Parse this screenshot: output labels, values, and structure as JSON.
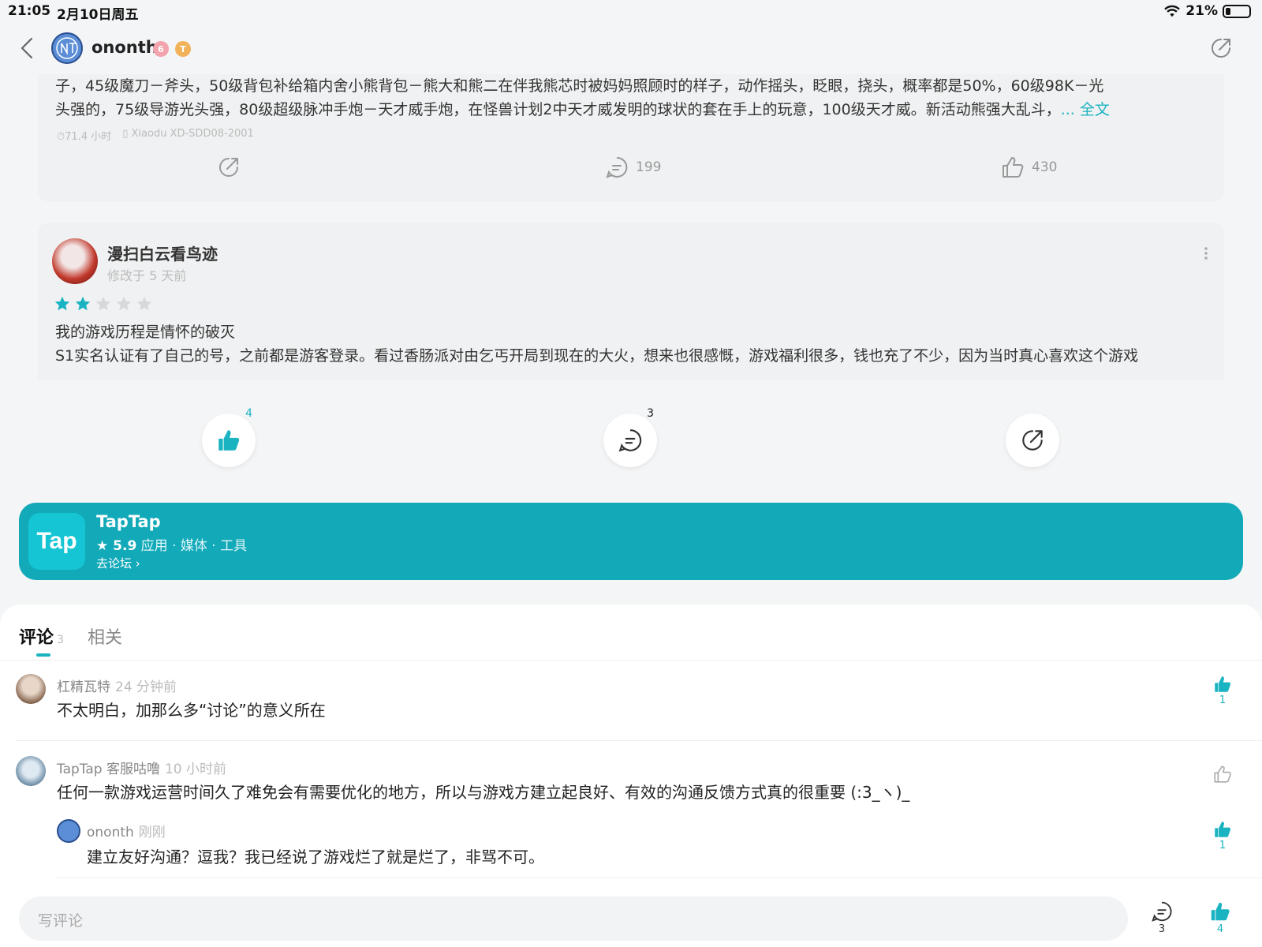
{
  "status": {
    "time": "21:05",
    "date": "2月10日周五",
    "battery": "21%",
    "battery_level": 0.21
  },
  "header": {
    "username": "ononth",
    "level_badge": "6",
    "t_badge": "T"
  },
  "post1": {
    "text_line1": "子，45级魔刀－斧头，50级背包补给箱内舍小熊背包－熊大和熊二在伴我熊芯时被妈妈照顾时的样子，动作摇头，眨眼，挠头，概率都是50%，60级98K－光",
    "text_line2": "头强的，75级导游光头强，80级超级脉冲手炮－天才威手炮，在怪兽计划2中天才威发明的球状的套在手上的玩意，100级天才威。新活动熊强大乱斗，",
    "more": "... 全文",
    "playtime": "71.4 小时",
    "device": "Xiaodu XD-SDD08-2001",
    "comment_count": "199",
    "like_count": "430"
  },
  "post2": {
    "name": "漫扫白云看鸟迹",
    "time": "修改于 5 天前",
    "rating": 2,
    "title": "我的游戏历程是情怀的破灭",
    "body": "S1实名认证有了自己的号，之前都是游客登录。看过香肠派对由乞丐开局到现在的大火，想来也很感慨，游戏福利很多，钱也充了不少，因为当时真心喜欢这个游戏"
  },
  "actions": {
    "like_count": "4",
    "comment_count": "3"
  },
  "banner": {
    "logo": "Tap",
    "name": "TapTap",
    "rating": "★ 5.9",
    "categories": " 应用 · 媒体 · 工具",
    "forum": "去论坛"
  },
  "tabs": [
    {
      "label": "评论",
      "count": "3"
    },
    {
      "label": "相关"
    }
  ],
  "comments": [
    {
      "user": "杠精瓦特",
      "time": "24 分钟前",
      "text": "不太明白，加那么多“讨论”的意义所在",
      "likes": "1"
    },
    {
      "user": "TapTap 客服咕噜",
      "time": "10 小时前",
      "text": "任何一款游戏运营时间久了难免会有需要优化的地方，所以与游戏方建立起良好、有效的沟通反馈方式真的很重要 (:3_ヽ)_",
      "likes": ""
    },
    {
      "user": "ononth",
      "time": "刚刚",
      "text": "建立友好沟通？逗我？我已经说了游戏烂了就是烂了，非骂不可。",
      "likes": "1"
    }
  ],
  "bottom": {
    "placeholder": "写评论",
    "comment_count": "3",
    "like_count": "4"
  },
  "colors": {
    "accent": "#19b3c1",
    "banner": "#12a9b8"
  }
}
